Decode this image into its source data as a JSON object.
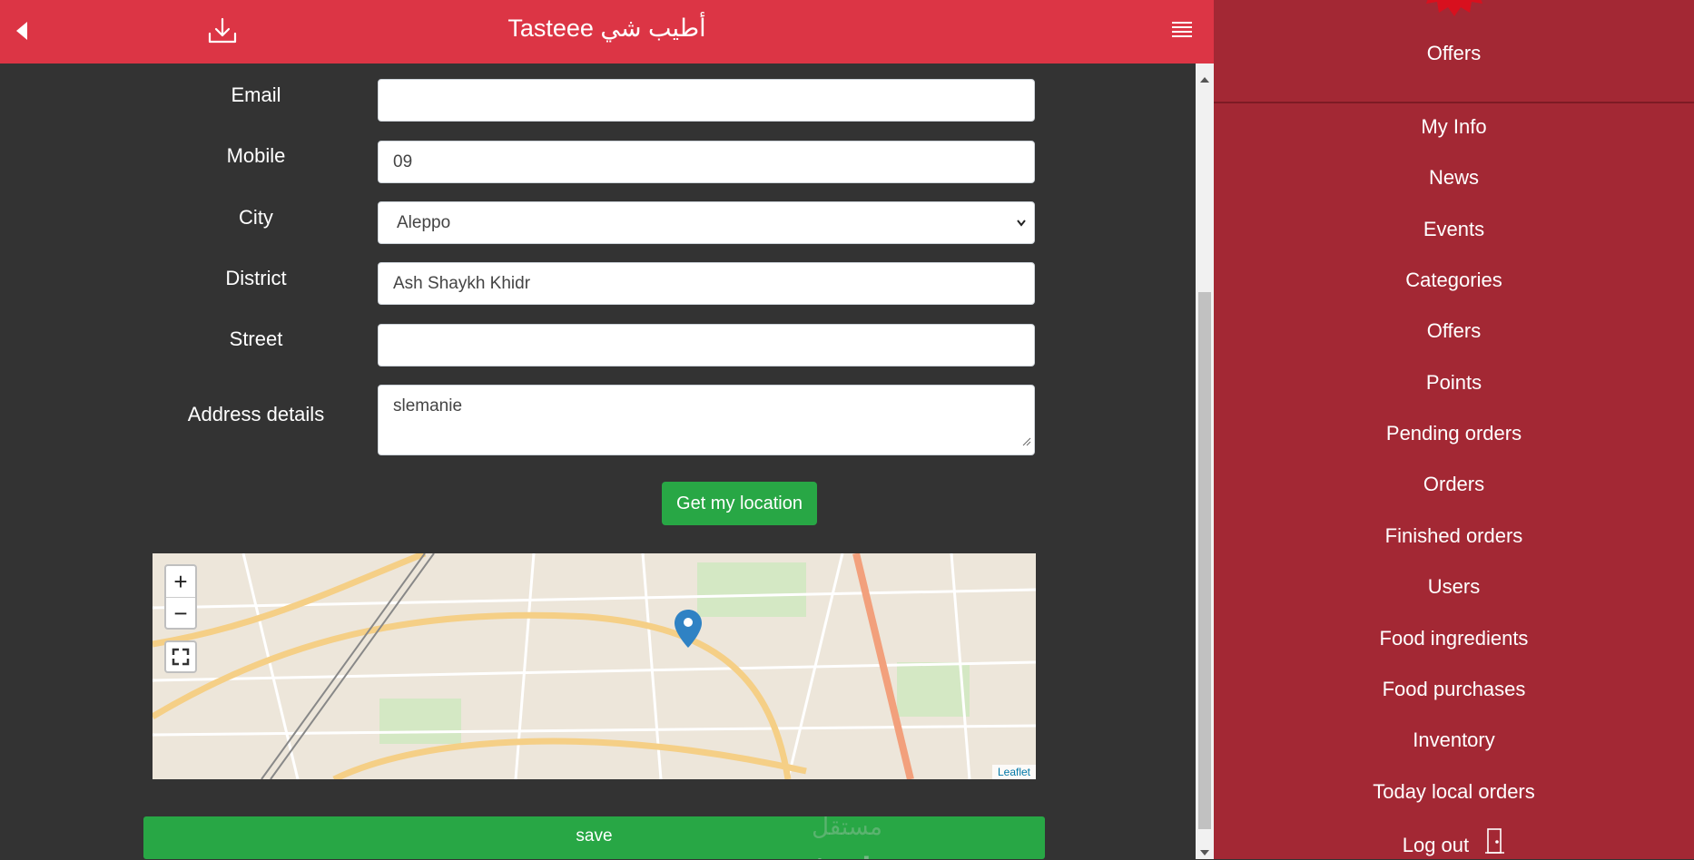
{
  "header": {
    "title": "Tasteee أطيب شي",
    "back_icon": "back-arrow-icon",
    "download_icon": "download-icon",
    "menu_icon": "hamburger-menu-icon",
    "bg_color": "#dc3545"
  },
  "form": {
    "email": {
      "label": "Email",
      "value": ""
    },
    "mobile": {
      "label": "Mobile",
      "value": "09"
    },
    "city": {
      "label": "City",
      "value": "Aleppo"
    },
    "district": {
      "label": "District",
      "value": "Ash Shaykh Khidr"
    },
    "street": {
      "label": "Street",
      "value": ""
    },
    "address_details": {
      "label": "Address details",
      "value": "slemanie"
    }
  },
  "get_location_label": "Get my location",
  "map": {
    "zoom_in": "+",
    "zoom_out": "−",
    "attribution": "Leaflet",
    "fullscreen_icon": "fullscreen-icon",
    "marker_icon": "map-marker-icon"
  },
  "save_label": "save",
  "watermark": {
    "text": "mostaql.com",
    "arabic": "مستقل"
  },
  "sidebar": {
    "bg_color": "#a32834",
    "top_label": "Offers",
    "items": [
      {
        "label": "My Info"
      },
      {
        "label": "News"
      },
      {
        "label": "Events"
      },
      {
        "label": "Categories"
      },
      {
        "label": "Offers"
      },
      {
        "label": "Points"
      },
      {
        "label": "Pending orders"
      },
      {
        "label": "Orders"
      },
      {
        "label": "Finished orders"
      },
      {
        "label": "Users"
      },
      {
        "label": "Food ingredients"
      },
      {
        "label": "Food purchases"
      },
      {
        "label": "Inventory"
      },
      {
        "label": "Today local orders"
      },
      {
        "label": "Log out"
      }
    ],
    "logout_icon": "door-exit-icon"
  }
}
